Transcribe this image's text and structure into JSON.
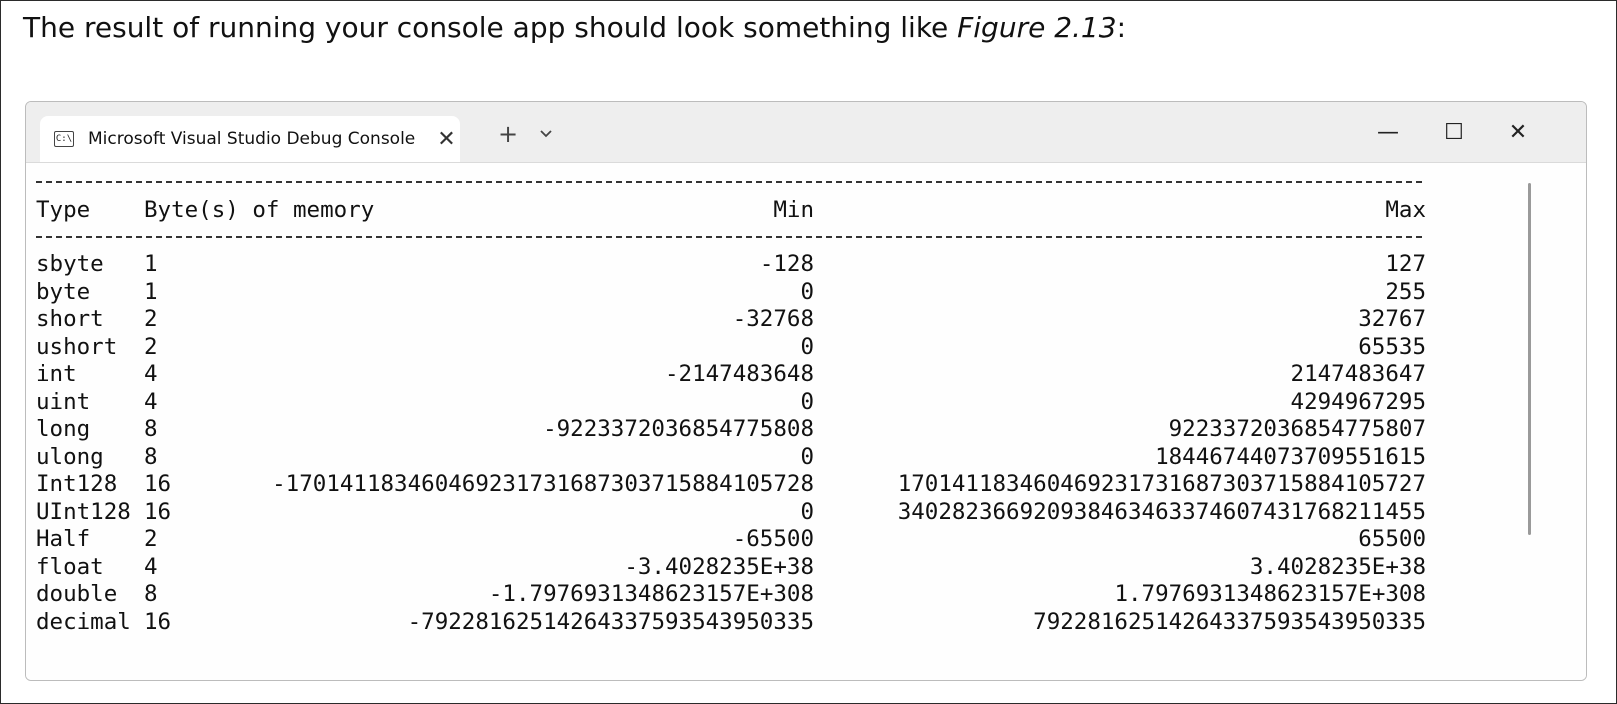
{
  "intro": {
    "prefix": "The result of running your console app should look something like ",
    "figure_ref": "Figure 2.13",
    "suffix": ":"
  },
  "window": {
    "tab_title": "Microsoft Visual Studio Debug Console",
    "tab_icon_text": "C:\\",
    "close_tab_glyph": "✕",
    "new_tab_glyph": "+",
    "minimize_glyph": "—",
    "maximize_glyph": "☐",
    "close_glyph": "✕"
  },
  "console": {
    "headers": {
      "type": "Type",
      "bytes": "Byte(s) of memory",
      "min": "Min",
      "max": "Max"
    },
    "rows": [
      {
        "type": "sbyte",
        "bytes": "1",
        "min": "-128",
        "max": "127"
      },
      {
        "type": "byte",
        "bytes": "1",
        "min": "0",
        "max": "255"
      },
      {
        "type": "short",
        "bytes": "2",
        "min": "-32768",
        "max": "32767"
      },
      {
        "type": "ushort",
        "bytes": "2",
        "min": "0",
        "max": "65535"
      },
      {
        "type": "int",
        "bytes": "4",
        "min": "-2147483648",
        "max": "2147483647"
      },
      {
        "type": "uint",
        "bytes": "4",
        "min": "0",
        "max": "4294967295"
      },
      {
        "type": "long",
        "bytes": "8",
        "min": "-9223372036854775808",
        "max": "9223372036854775807"
      },
      {
        "type": "ulong",
        "bytes": "8",
        "min": "0",
        "max": "18446744073709551615"
      },
      {
        "type": "Int128",
        "bytes": "16",
        "min": "-170141183460469231731687303715884105728",
        "max": "170141183460469231731687303715884105727"
      },
      {
        "type": "UInt128",
        "bytes": "16",
        "min": "0",
        "max": "340282366920938463463374607431768211455"
      },
      {
        "type": "Half",
        "bytes": "2",
        "min": "-65500",
        "max": "65500"
      },
      {
        "type": "float",
        "bytes": "4",
        "min": "-3.4028235E+38",
        "max": "3.4028235E+38"
      },
      {
        "type": "double",
        "bytes": "8",
        "min": "-1.7976931348623157E+308",
        "max": "1.7976931348623157E+308"
      },
      {
        "type": "decimal",
        "bytes": "16",
        "min": "-79228162514264337593543950335",
        "max": "79228162514264337593543950335"
      }
    ]
  }
}
